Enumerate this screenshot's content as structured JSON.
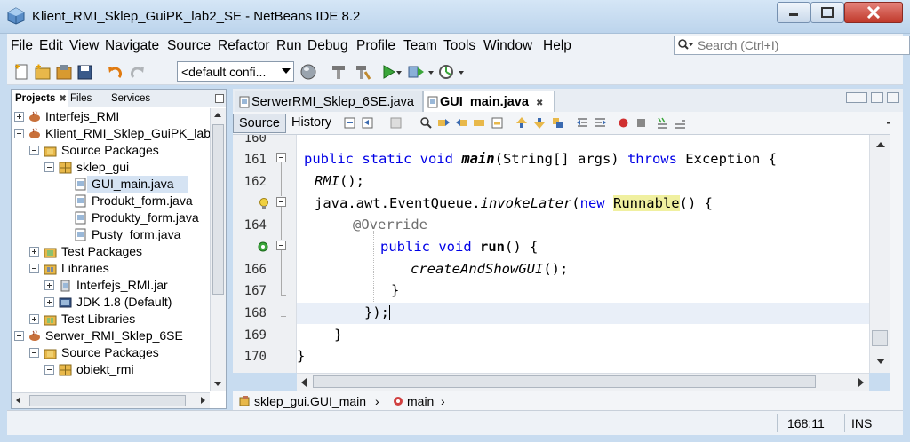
{
  "window": {
    "title": "Klient_RMI_Sklep_GuiPK_lab2_SE - NetBeans IDE 8.2"
  },
  "menu": [
    {
      "label": "File"
    },
    {
      "label": "Edit"
    },
    {
      "label": "View"
    },
    {
      "label": "Navigate"
    },
    {
      "label": "Source"
    },
    {
      "label": "Refactor"
    },
    {
      "label": "Run"
    },
    {
      "label": "Debug"
    },
    {
      "label": "Profile"
    },
    {
      "label": "Team"
    },
    {
      "label": "Tools"
    },
    {
      "label": "Window"
    },
    {
      "label": "Help"
    }
  ],
  "search": {
    "placeholder": "Search (Ctrl+I)"
  },
  "toolbar": {
    "config": "<default confi..."
  },
  "left_panel": {
    "tabs": [
      "Projects",
      "Files",
      "Services"
    ],
    "tree": [
      {
        "label": "Interfejs_RMI"
      },
      {
        "label": "Klient_RMI_Sklep_GuiPK_lab"
      },
      {
        "label": "Source Packages"
      },
      {
        "label": "sklep_gui"
      },
      {
        "label": "GUI_main.java"
      },
      {
        "label": "Produkt_form.java"
      },
      {
        "label": "Produkty_form.java"
      },
      {
        "label": "Pusty_form.java"
      },
      {
        "label": "Test Packages"
      },
      {
        "label": "Libraries"
      },
      {
        "label": "Interfejs_RMI.jar"
      },
      {
        "label": "JDK 1.8 (Default)"
      },
      {
        "label": "Test Libraries"
      },
      {
        "label": "Serwer_RMI_Sklep_6SE"
      },
      {
        "label": "Source Packages"
      },
      {
        "label": "obiekt_rmi"
      }
    ]
  },
  "editor": {
    "tabs": [
      "SerwerRMI_Sklep_6SE.java",
      "GUI_main.java"
    ],
    "source_label": "Source",
    "history_label": "History",
    "line_numbers": [
      "160",
      "161",
      "162",
      "",
      "164",
      "",
      "166",
      "167",
      "168",
      "169",
      "170"
    ],
    "code": {
      "l161_kw1": "public static void ",
      "l161_fn": "main",
      "l161_mid": "(String[] args) ",
      "l161_kw2": "throws",
      "l161_end": " Exception {",
      "l162_fn": "RMI",
      "l162_end": "();",
      "l163_a": "java.awt.EventQueue.",
      "l163_fn": "invokeLater",
      "l163_b": "(",
      "l163_kw": "new",
      "l163_hl": "Runnable",
      "l163_end": "() {",
      "l164": "@Override",
      "l165_kw": "public void ",
      "l165_fn": "run",
      "l165_end": "() {",
      "l166_fn": "createAndShowGUI",
      "l166_end": "();",
      "l167": "}",
      "l168": "});",
      "l169": "}",
      "l170": "}"
    }
  },
  "breadcrumbs": [
    "sklep_gui.GUI_main",
    "main"
  ],
  "status": {
    "position": "168:11",
    "mode": "INS"
  }
}
